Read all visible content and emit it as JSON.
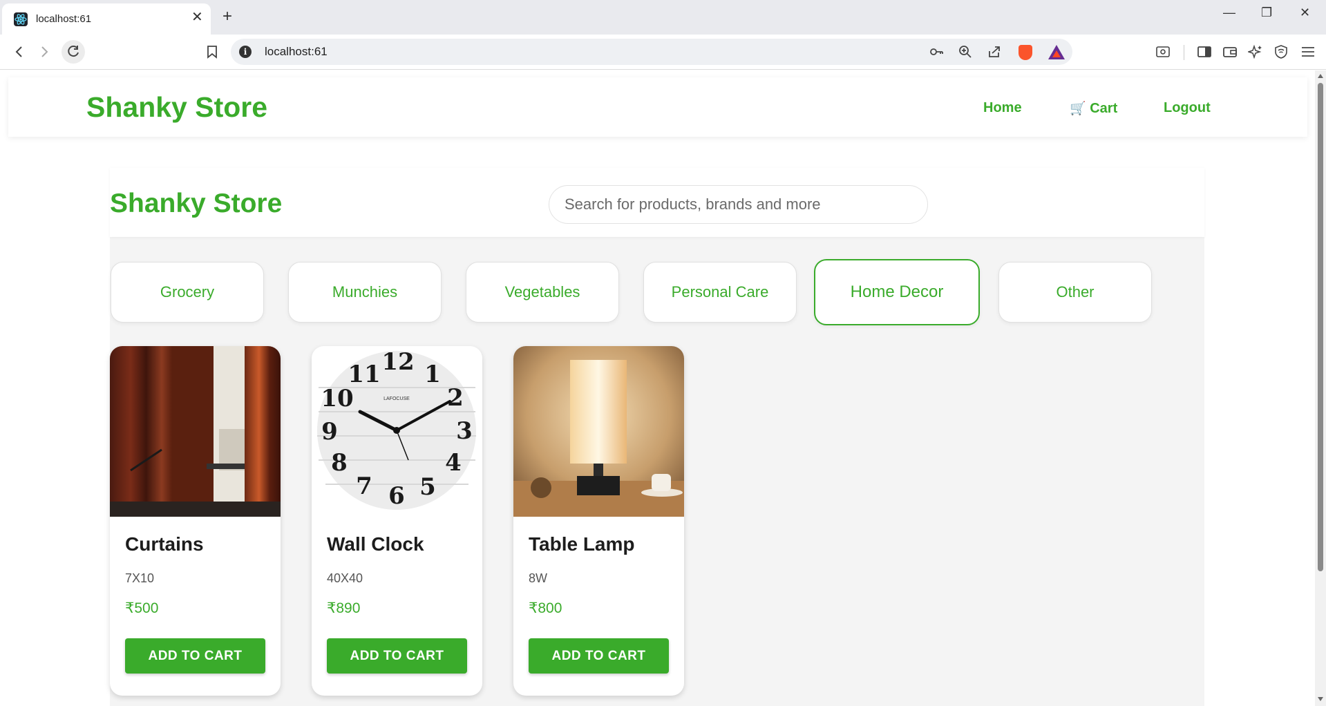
{
  "browser": {
    "tab_title": "localhost:61",
    "tab_close": "✕",
    "new_tab": "+",
    "url": "localhost:61",
    "window_controls": {
      "minimize": "—",
      "restore": "❐",
      "close": "✕"
    },
    "icons": [
      "back-icon",
      "forward-icon",
      "reload-icon",
      "bookmark-icon",
      "info-icon",
      "key-icon",
      "zoom-icon",
      "share-icon",
      "brave-shields-icon",
      "brave-rewards-icon",
      "screenshot-icon",
      "sidebar-icon",
      "wallet-icon",
      "leo-ai-icon",
      "vpn-icon",
      "menu-icon"
    ]
  },
  "navbar": {
    "brand": "Shanky Store",
    "links": {
      "home": "Home",
      "cart": "Cart",
      "cart_icon": "🛒",
      "logout": "Logout"
    }
  },
  "hero": {
    "title": "Shanky Store",
    "search_placeholder": "Search for products, brands and more"
  },
  "categories": [
    {
      "label": "Grocery",
      "active": false
    },
    {
      "label": "Munchies",
      "active": false
    },
    {
      "label": "Vegetables",
      "active": false
    },
    {
      "label": "Personal Care",
      "active": false
    },
    {
      "label": "Home Decor",
      "active": true
    },
    {
      "label": "Other",
      "active": false
    }
  ],
  "products": [
    {
      "name": "Curtains",
      "size": "7X10",
      "price": "₹500",
      "button": "ADD TO CART",
      "image": "curtains-photo"
    },
    {
      "name": "Wall Clock",
      "size": "40X40",
      "price": "₹890",
      "button": "ADD TO CART",
      "image": "wall-clock-photo"
    },
    {
      "name": "Table Lamp",
      "size": "8W",
      "price": "₹800",
      "button": "ADD TO CART",
      "image": "table-lamp-photo"
    }
  ],
  "clock_numbers": [
    "12",
    "1",
    "2",
    "3",
    "4",
    "5",
    "6",
    "7",
    "8",
    "9",
    "10",
    "11"
  ],
  "clock_brand": "LAFOCUSE",
  "colors": {
    "accent": "#3aab2b",
    "page_bg": "#f4f4f4"
  }
}
